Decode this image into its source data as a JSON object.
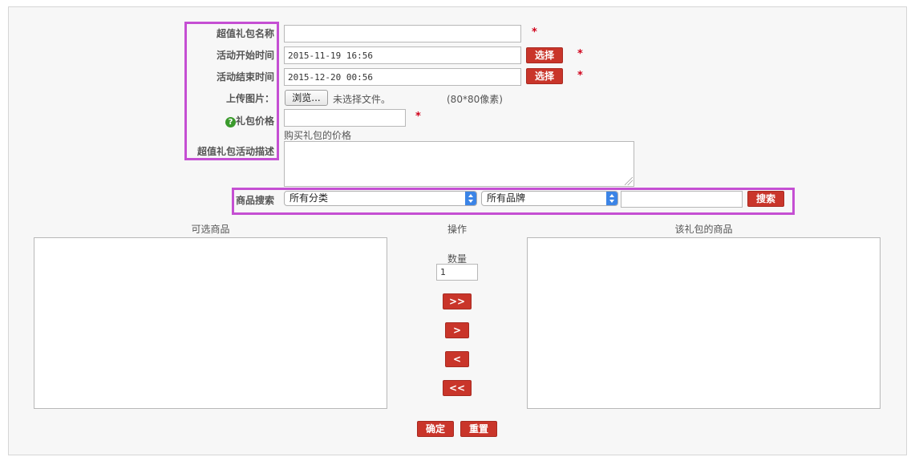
{
  "form": {
    "name_label": "超值礼包名称",
    "name_value": "",
    "start_label": "活动开始时间",
    "start_value": "2015-11-19 16:56",
    "end_label": "活动结束时间",
    "end_value": "2015-12-20 00:56",
    "select_label": "选择",
    "upload_label": "上传图片：",
    "browse_label": "浏览...",
    "no_file_text": "未选择文件。",
    "size_hint": "(80*80像素)",
    "price_label": "礼包价格",
    "price_value": "",
    "price_hint": "购买礼包的价格",
    "desc_label": "超值礼包活动描述",
    "desc_value": "",
    "required_mark": "*"
  },
  "search": {
    "label": "商品搜索",
    "category_selected": "所有分类",
    "brand_selected": "所有品牌",
    "keyword_value": "",
    "button_label": "搜索"
  },
  "transfer": {
    "available_caption": "可选商品",
    "operation_caption": "操作",
    "selected_caption": "该礼包的商品",
    "quantity_label": "数量",
    "quantity_value": "1",
    "add_all_label": ">>",
    "add_one_label": ">",
    "remove_one_label": "<",
    "remove_all_label": "<<"
  },
  "actions": {
    "confirm_label": "确定",
    "reset_label": "重置"
  },
  "colors": {
    "accent_red": "#c9352a",
    "highlight_purple": "#c54fd3",
    "select_blue": "#3b84e6",
    "help_green": "#3a9a2c"
  }
}
